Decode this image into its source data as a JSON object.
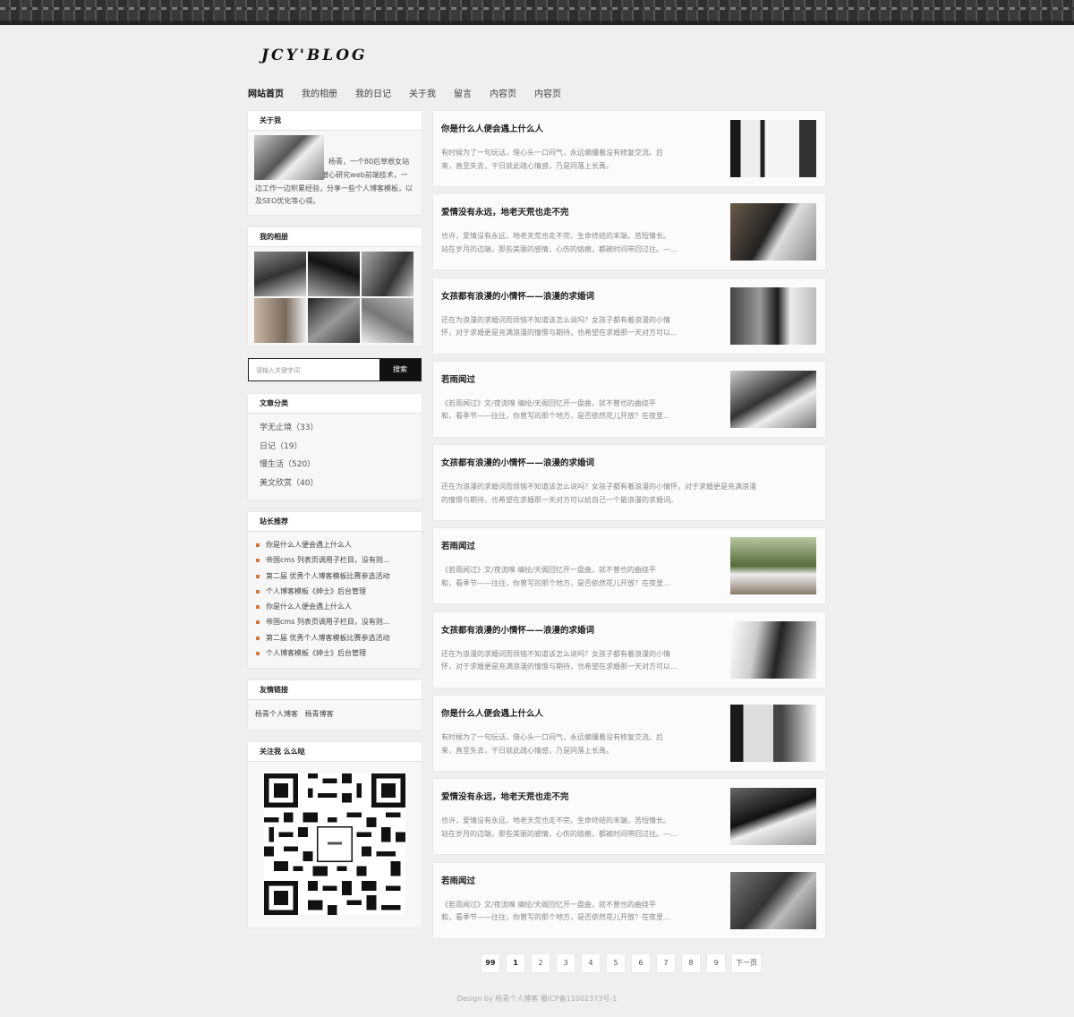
{
  "site": {
    "logo": "JCY'BLOG"
  },
  "nav": [
    "网站首页",
    "我的相册",
    "我的日记",
    "关于我",
    "留言",
    "内容页",
    "内容页"
  ],
  "about": {
    "title": "关于我",
    "text": "杨青，一个80后草根女站长！09年入行。一直潜心研究web前端技术，一边工作一边积累经验，分享一些个人博客模板，以及SEO优化等心得。"
  },
  "album": {
    "title": "我的相册"
  },
  "search": {
    "placeholder": "请输入关键字词",
    "button": "搜索"
  },
  "categories": {
    "title": "文章分类",
    "items": [
      "学无止境（33）",
      "日记（19）",
      "慢生活（520）",
      "美文欣赏（40）"
    ]
  },
  "recommend": {
    "title": "站长推荐",
    "items": [
      "你是什么人便会遇上什么人",
      "帝国cms 列表页调用子栏目，没有则...",
      "第二届 优秀个人博客模板比赛参选活动",
      "个人博客模板《绅士》后台管理",
      "你是什么人便会遇上什么人",
      "帝国cms 列表页调用子栏目，没有则...",
      "第二届 优秀个人博客模板比赛参选活动",
      "个人博客模板《绅士》后台管理"
    ]
  },
  "links": {
    "title": "友情链接",
    "items": [
      "杨青个人博客",
      "杨青博客"
    ]
  },
  "follow": {
    "title": "关注我 么么哒"
  },
  "articles": [
    {
      "title": "你是什么人便会遇上什么人",
      "l1": "有时候为了一句玩话，借心头一口闷气，永远偏僵着没有修复交流。后",
      "l2": "来，直至失去，干日就此疏心情感，乃是同落上长禹。"
    },
    {
      "title": "爱情没有永远，地老天荒也走不完",
      "l1": "也许，爱情没有永远，地老天荒也走不完，生命终结的末端，苦短情长。",
      "l2": "站在岁月的边端，那些美丽的感情，心伤的烙痕，都被时间带回过往。—..."
    },
    {
      "title": "女孩都有浪漫的小情怀——浪漫的求婚词",
      "l1": "还在为浪漫的求婚词而烦恼不知道该怎么说吗？女孩子都有着浪漫的小情",
      "l2": "怀，对于求婚更是充满浪漫的憧憬与期待，也希望在求婚那一天对方可以..."
    },
    {
      "title": "若雨闻过",
      "l1": "《若雨闻过》文/夜流嗅 编绘/天阁回忆开一盘曲，就不曾也的曲绕平",
      "l2": "和，看季节——往往，你曾写的那个地方，是否依然花儿开放？在夜里..."
    },
    {
      "title": "女孩都有浪漫的小情怀——浪漫的求婚词",
      "l1": "还在为浪漫的求婚词而烦恼不知道该怎么说吗？女孩子都有着浪漫的小情怀，对于求婚更是充满浪漫",
      "l2": "的憧憬与期待，也希望在求婚那一天对方可以给自己一个最浪漫的求婚词。"
    },
    {
      "title": "若雨闻过",
      "l1": "《若雨闻过》文/夜流嗅 编绘/天阁回忆开一盘曲，就不曾也的曲绕平",
      "l2": "和，看季节——往往，你曾写的那个地方，是否依然花儿开放？在夜里..."
    },
    {
      "title": "女孩都有浪漫的小情怀——浪漫的求婚词",
      "l1": "还在为浪漫的求婚词而烦恼不知道该怎么说吗？女孩子都有着浪漫的小情",
      "l2": "怀，对于求婚更是充满浪漫的憧憬与期待，也希望在求婚那一天对方可以..."
    },
    {
      "title": "你是什么人便会遇上什么人",
      "l1": "有时候为了一句玩话，借心头一口闷气，永远偏僵着没有修复交流。后",
      "l2": "来，直至失去，干日就此疏心情感，乃是同落上长禹。"
    },
    {
      "title": "爱情没有永远，地老天荒也走不完",
      "l1": "也许，爱情没有永远，地老天荒也走不完，生命终结的末端，苦短情长。",
      "l2": "站在岁月的边端，那些美丽的感情，心伤的烙痕，都被时间带回过往。—..."
    },
    {
      "title": "若雨闻过",
      "l1": "《若雨闻过》文/夜流嗅 编绘/天阁回忆开一盘曲，就不曾也的曲绕平",
      "l2": "和，看季节——往往，你曾写的那个地方，是否依然花儿开放？在夜里..."
    }
  ],
  "pager": [
    "99",
    "1",
    "2",
    "3",
    "4",
    "5",
    "6",
    "7",
    "8",
    "9",
    "下一页"
  ],
  "footer": "Design by 杨青个人博客 蜀ICP备11002373号-1"
}
